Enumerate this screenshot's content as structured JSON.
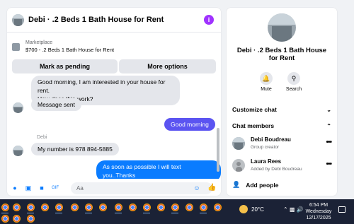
{
  "chat": {
    "title": "Debi · .2 Beds 1 Bath House for Rent",
    "info_icon": "info-icon",
    "marketplace_label": "Marketplace",
    "listing": "$700 - .2 Beds 1 Bath House for Rent",
    "mark_pending": "Mark as pending",
    "more_options": "More options",
    "messages": [
      {
        "text_1": "Good morning, I am interested in your house for rent.",
        "text_2": "How does this work?"
      },
      {
        "text": "Message sent"
      },
      {
        "text": "Good morning"
      },
      {
        "sender": "Debi",
        "text": "My number is 978 894-5885"
      },
      {
        "text": "As soon as possible I will text you..Thanks"
      }
    ],
    "composer_placeholder": "Aa",
    "colors": {
      "accent": "#0a7cff",
      "outgoing_purple": "#5b54f1",
      "info": "#a033ff"
    }
  },
  "panel": {
    "title": "Debi · .2 Beds 1 Bath House for Rent",
    "mute": "Mute",
    "search": "Search",
    "customize_chat": "Customize chat",
    "chat_members": "Chat members",
    "members": [
      {
        "name": "Debi Boudreau",
        "role": "Group creator"
      },
      {
        "name": "Laura Rees",
        "role": "Added by Debi Boudreau"
      }
    ],
    "add_people": "Add people"
  },
  "taskbar": {
    "temperature": "20°C",
    "time": "6:54 PM",
    "day": "Wednesday",
    "date": "12/17/2025"
  }
}
